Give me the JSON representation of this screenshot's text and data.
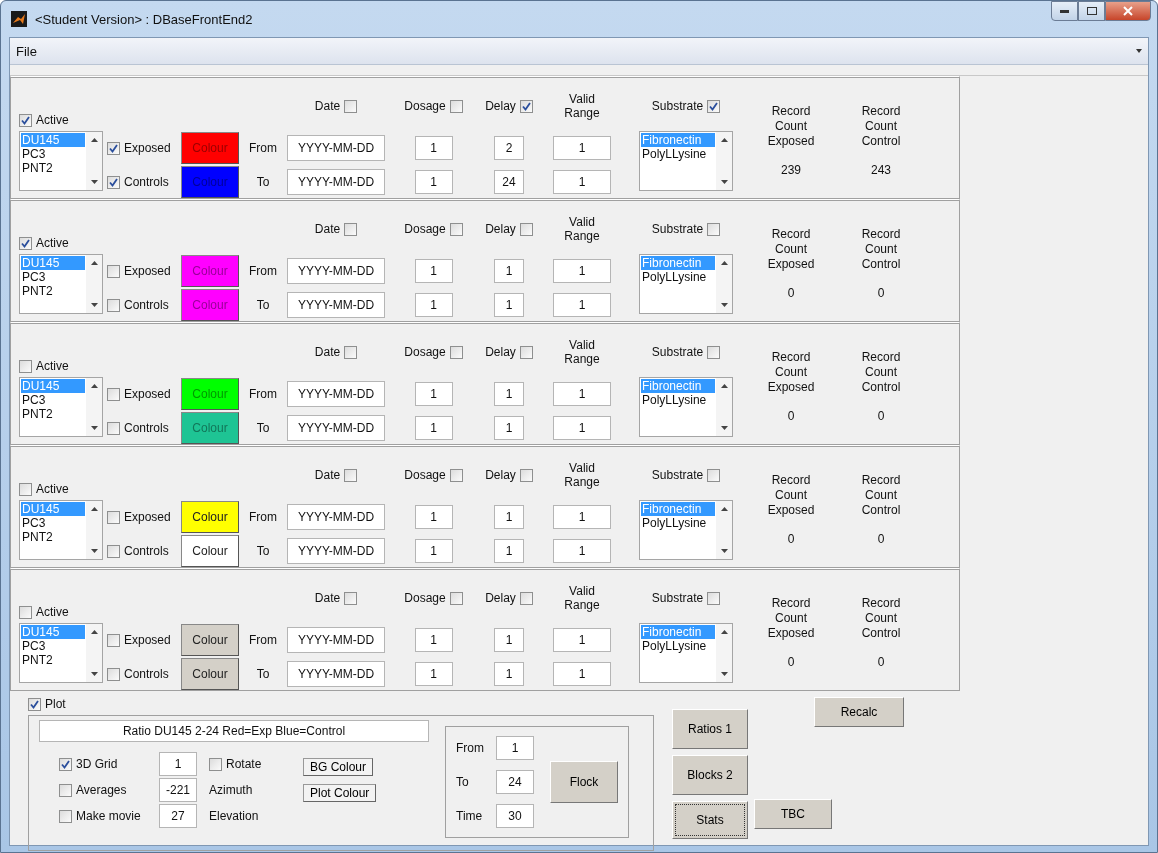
{
  "window": {
    "title": "<Student Version> : DBaseFrontEnd2"
  },
  "menu": [
    "File"
  ],
  "groups": [
    {
      "active": {
        "label": "Active",
        "checked": true
      },
      "cell_lines": [
        {
          "label": "DU145",
          "selected": true
        },
        {
          "label": "PC3",
          "selected": false
        },
        {
          "label": "PNT2",
          "selected": false
        }
      ],
      "exposed": {
        "label": "Exposed",
        "checked": true,
        "colour_button": {
          "label": "Colour",
          "color": "#ff0000"
        }
      },
      "controls": {
        "label": "Controls",
        "checked": true,
        "colour_button": {
          "label": "Colour",
          "color": "#0000ff"
        }
      },
      "from_label": "From",
      "to_label": "To",
      "date": {
        "label": "Date",
        "checked": false,
        "from": "YYYY-MM-DD",
        "to": "YYYY-MM-DD"
      },
      "dosage": {
        "label": "Dosage",
        "checked": false,
        "from": "1",
        "to": "1"
      },
      "delay": {
        "label": "Delay",
        "checked": true,
        "from": "2",
        "to": "24"
      },
      "valid_range": {
        "label": "Valid Range",
        "from": "1",
        "to": "1"
      },
      "substrate": {
        "label": "Substrate",
        "checked": true,
        "options": [
          {
            "label": "Fibronectin",
            "selected": true
          },
          {
            "label": "PolyLLysine",
            "selected": false
          }
        ]
      },
      "record_count_exposed": {
        "label": "Record Count Exposed",
        "value": "239"
      },
      "record_count_control": {
        "label": "Record Count Control",
        "value": "243"
      }
    },
    {
      "active": {
        "label": "Active",
        "checked": true
      },
      "cell_lines": [
        {
          "label": "DU145",
          "selected": true
        },
        {
          "label": "PC3",
          "selected": false
        },
        {
          "label": "PNT2",
          "selected": false
        }
      ],
      "exposed": {
        "label": "Exposed",
        "checked": false,
        "colour_button": {
          "label": "Colour",
          "color": "#ff00ff"
        }
      },
      "controls": {
        "label": "Controls",
        "checked": false,
        "colour_button": {
          "label": "Colour",
          "color": "#ff00ff"
        }
      },
      "from_label": "From",
      "to_label": "To",
      "date": {
        "label": "Date",
        "checked": false,
        "from": "YYYY-MM-DD",
        "to": "YYYY-MM-DD"
      },
      "dosage": {
        "label": "Dosage",
        "checked": false,
        "from": "1",
        "to": "1"
      },
      "delay": {
        "label": "Delay",
        "checked": false,
        "from": "1",
        "to": "1"
      },
      "valid_range": {
        "label": "Valid Range",
        "from": "1",
        "to": "1"
      },
      "substrate": {
        "label": "Substrate",
        "checked": false,
        "options": [
          {
            "label": "Fibronectin",
            "selected": true
          },
          {
            "label": "PolyLLysine",
            "selected": false
          }
        ]
      },
      "record_count_exposed": {
        "label": "Record Count Exposed",
        "value": "0"
      },
      "record_count_control": {
        "label": "Record Count Control",
        "value": "0"
      }
    },
    {
      "active": {
        "label": "Active",
        "checked": false
      },
      "cell_lines": [
        {
          "label": "DU145",
          "selected": true
        },
        {
          "label": "PC3",
          "selected": false
        },
        {
          "label": "PNT2",
          "selected": false
        }
      ],
      "exposed": {
        "label": "Exposed",
        "checked": false,
        "colour_button": {
          "label": "Colour",
          "color": "#00ff00"
        }
      },
      "controls": {
        "label": "Controls",
        "checked": false,
        "colour_button": {
          "label": "Colour",
          "color": "#1ec494"
        }
      },
      "from_label": "From",
      "to_label": "To",
      "date": {
        "label": "Date",
        "checked": false,
        "from": "YYYY-MM-DD",
        "to": "YYYY-MM-DD"
      },
      "dosage": {
        "label": "Dosage",
        "checked": false,
        "from": "1",
        "to": "1"
      },
      "delay": {
        "label": "Delay",
        "checked": false,
        "from": "1",
        "to": "1"
      },
      "valid_range": {
        "label": "Valid Range",
        "from": "1",
        "to": "1"
      },
      "substrate": {
        "label": "Substrate",
        "checked": false,
        "options": [
          {
            "label": "Fibronectin",
            "selected": true
          },
          {
            "label": "PolyLLysine",
            "selected": false
          }
        ]
      },
      "record_count_exposed": {
        "label": "Record Count Exposed",
        "value": "0"
      },
      "record_count_control": {
        "label": "Record Count Control",
        "value": "0"
      }
    },
    {
      "active": {
        "label": "Active",
        "checked": false
      },
      "cell_lines": [
        {
          "label": "DU145",
          "selected": true
        },
        {
          "label": "PC3",
          "selected": false
        },
        {
          "label": "PNT2",
          "selected": false
        }
      ],
      "exposed": {
        "label": "Exposed",
        "checked": false,
        "colour_button": {
          "label": "Colour",
          "color": "#ffff00"
        }
      },
      "controls": {
        "label": "Controls",
        "checked": false,
        "colour_button": {
          "label": "Colour",
          "color": "#ffffff"
        }
      },
      "from_label": "From",
      "to_label": "To",
      "date": {
        "label": "Date",
        "checked": false,
        "from": "YYYY-MM-DD",
        "to": "YYYY-MM-DD"
      },
      "dosage": {
        "label": "Dosage",
        "checked": false,
        "from": "1",
        "to": "1"
      },
      "delay": {
        "label": "Delay",
        "checked": false,
        "from": "1",
        "to": "1"
      },
      "valid_range": {
        "label": "Valid Range",
        "from": "1",
        "to": "1"
      },
      "substrate": {
        "label": "Substrate",
        "checked": false,
        "options": [
          {
            "label": "Fibronectin",
            "selected": true
          },
          {
            "label": "PolyLLysine",
            "selected": false
          }
        ]
      },
      "record_count_exposed": {
        "label": "Record Count Exposed",
        "value": "0"
      },
      "record_count_control": {
        "label": "Record Count Control",
        "value": "0"
      }
    },
    {
      "active": {
        "label": "Active",
        "checked": false
      },
      "cell_lines": [
        {
          "label": "DU145",
          "selected": true
        },
        {
          "label": "PC3",
          "selected": false
        },
        {
          "label": "PNT2",
          "selected": false
        }
      ],
      "exposed": {
        "label": "Exposed",
        "checked": false,
        "colour_button": {
          "label": "Colour",
          "color": "#d4d0c8"
        }
      },
      "controls": {
        "label": "Controls",
        "checked": false,
        "colour_button": {
          "label": "Colour",
          "color": "#d4d0c8"
        }
      },
      "from_label": "From",
      "to_label": "To",
      "date": {
        "label": "Date",
        "checked": false,
        "from": "YYYY-MM-DD",
        "to": "YYYY-MM-DD"
      },
      "dosage": {
        "label": "Dosage",
        "checked": false,
        "from": "1",
        "to": "1"
      },
      "delay": {
        "label": "Delay",
        "checked": false,
        "from": "1",
        "to": "1"
      },
      "valid_range": {
        "label": "Valid Range",
        "from": "1",
        "to": "1"
      },
      "substrate": {
        "label": "Substrate",
        "checked": false,
        "options": [
          {
            "label": "Fibronectin",
            "selected": true
          },
          {
            "label": "PolyLLysine",
            "selected": false
          }
        ]
      },
      "record_count_exposed": {
        "label": "Record Count Exposed",
        "value": "0"
      },
      "record_count_control": {
        "label": "Record Count Control",
        "value": "0"
      }
    }
  ],
  "plot": {
    "checkbox": {
      "label": "Plot",
      "checked": true
    },
    "title": "Ratio DU145 2-24 Red=Exp Blue=Control",
    "options": [
      {
        "label": "3D Grid",
        "checked": true
      },
      {
        "label": "Averages",
        "checked": false
      },
      {
        "label": "Make movie",
        "checked": false
      }
    ],
    "view": [
      {
        "kind": "checkbox",
        "value": "1",
        "label": "Rotate",
        "checked": false
      },
      {
        "kind": "text",
        "value": "-221",
        "label": "Azimuth"
      },
      {
        "kind": "text",
        "value": "27",
        "label": "Elevation"
      }
    ],
    "colour_buttons": [
      "BG Colour",
      "Plot Colour"
    ],
    "flock": {
      "fields": [
        {
          "label": "From",
          "value": "1"
        },
        {
          "label": "To",
          "value": "24"
        },
        {
          "label": "Time",
          "value": "30"
        }
      ],
      "button": "Flock"
    }
  },
  "buttons": [
    {
      "label": "Ratios 1",
      "focused": false
    },
    {
      "label": "Blocks 2",
      "focused": false
    },
    {
      "label": "Stats",
      "focused": true
    }
  ],
  "tbc_button": "TBC",
  "recalc_button": "Recalc"
}
